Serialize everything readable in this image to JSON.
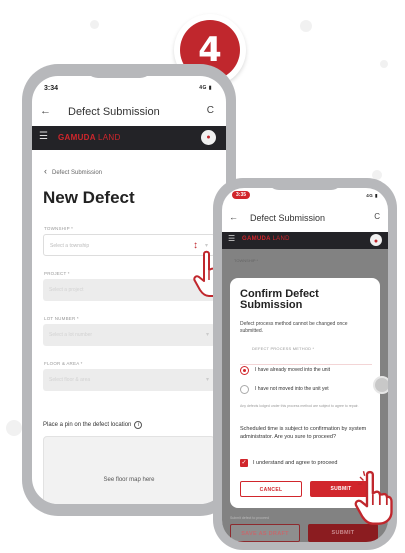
{
  "step": {
    "number": "4"
  },
  "colors": {
    "accent": "#d1262c",
    "brand_bar": "#232327",
    "device_frame": "#b7b8bb"
  },
  "phone1": {
    "status_time": "3:34",
    "status_icons": "4G",
    "back_icon": "arrow-left-icon",
    "screen_title": "Defect Submission",
    "refresh_icon": "refresh-icon",
    "brand_bold": "GAMUDA",
    "brand_light": "LAND",
    "breadcrumb": "Defect Submission",
    "page_title": "New Defect",
    "fields": [
      {
        "label": "TOWNSHIP *",
        "placeholder": "Select a township"
      },
      {
        "label": "PROJECT *",
        "placeholder": "Select a project"
      },
      {
        "label": "LOT NUMBER *",
        "placeholder": "Select a lot number"
      },
      {
        "label": "FLOOR & AREA *",
        "placeholder": "Select floor & area"
      }
    ],
    "pin_label": "Place a pin on the defect location",
    "map_placeholder": "See floor map here"
  },
  "phone2": {
    "status_time": "3:35",
    "status_icons": "4G",
    "screen_title": "Defect Submission",
    "brand_bold": "GAMUDA",
    "brand_light": "LAND",
    "background_label": "TOWNSHIP *",
    "modal": {
      "title": "Confirm Defect Submission",
      "description": "Defect process method cannot be changed once submitted.",
      "section_label": "DEFECT PROCESS METHOD *",
      "options": [
        {
          "label": "I have already moved into the unit",
          "selected": true
        },
        {
          "label": "I have not moved into the unit yet",
          "selected": false
        }
      ],
      "hint": "Any defects lodged under this process method are subject to agree to repair.",
      "note": "Scheduled time is subject to confirmation by system administrator. Are you sure to proceed?",
      "agree_label": "I understand and agree to proceed",
      "agree_checked": true,
      "cancel_label": "CANCEL",
      "submit_label": "SUBMIT"
    },
    "footer_hint": "Submit defect to proceed",
    "save_draft_label": "SAVE AS DRAFT",
    "submit_label": "SUBMIT"
  }
}
